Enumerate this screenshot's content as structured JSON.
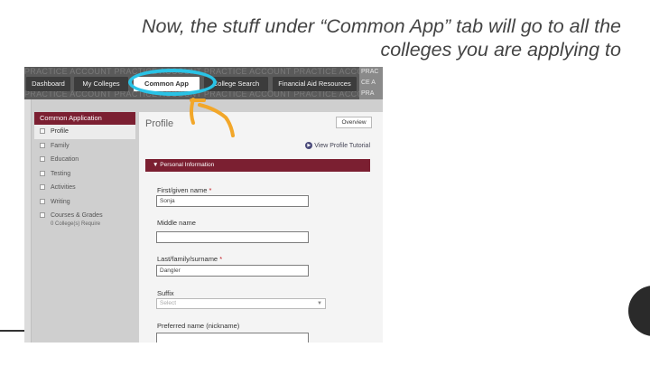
{
  "slide": {
    "caption_line1": "Now, the stuff under “Common App” tab will go to all the",
    "caption_line2": "colleges you are applying to"
  },
  "navbar": {
    "watermark": "PRACTICE ACCOUNT     PRACTICE ACCOUNT     PRACTICE ACCOUNT     PRACTICE ACCOUNT",
    "tabs": [
      "Dashboard",
      "My Colleges",
      "Common App",
      "College Search",
      "Financial Aid Resources"
    ],
    "active_tab": "Common App",
    "right_fragment": [
      "PRAC",
      "CE A",
      "PRA"
    ]
  },
  "sidebar": {
    "header": "Common Application",
    "items": [
      "Profile",
      "Family",
      "Education",
      "Testing",
      "Activities",
      "Writing",
      "Courses & Grades"
    ],
    "active_item": "Profile",
    "sub_note": "0 College(s) Require"
  },
  "content": {
    "title": "Profile",
    "overview_label": "Overview",
    "tutorial_link": "View Profile Tutorial",
    "section_header": "▼ Personal Information",
    "fields": [
      {
        "label": "First/given name",
        "required": "*",
        "value": "Sonja"
      },
      {
        "label": "Middle name",
        "required": "",
        "value": ""
      },
      {
        "label": "Last/family/surname",
        "required": "*",
        "value": "Dangler"
      },
      {
        "label": "Suffix",
        "required": "",
        "value": ""
      },
      {
        "label": "Preferred name (nickname)",
        "required": "",
        "value": ""
      }
    ],
    "suffix_placeholder": "Select"
  },
  "colors": {
    "accent_maroon": "#7b1f31",
    "highlight_ring": "#29c3e6",
    "arrow": "#f2a72a",
    "nav_bg": "#5a5a5a"
  }
}
